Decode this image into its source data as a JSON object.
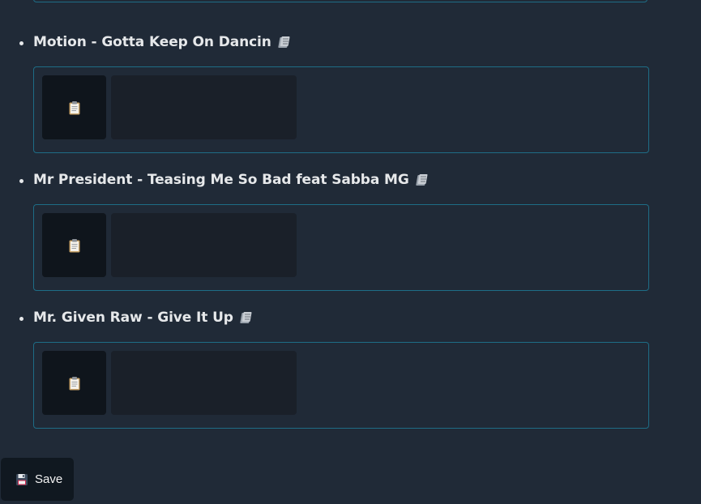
{
  "tracks": [
    {
      "title": "Motion - Gotta Keep On Dancin",
      "title_icon": "books-icon",
      "paste_icon": "clipboard-icon"
    },
    {
      "title": "Mr President - Teasing Me So Bad feat Sabba MG",
      "title_icon": "books-icon",
      "paste_icon": "clipboard-icon"
    },
    {
      "title": "Mr. Given Raw - Give It Up",
      "title_icon": "books-icon",
      "paste_icon": "clipboard-icon"
    }
  ],
  "save_button": {
    "label": "Save",
    "icon": "floppy-disk-icon"
  },
  "colors": {
    "background": "#202a37",
    "card_border": "#1e6d86",
    "paste_button_bg": "#0f151c",
    "slot_bg": "#1a2029",
    "text": "#e6e8ea"
  }
}
